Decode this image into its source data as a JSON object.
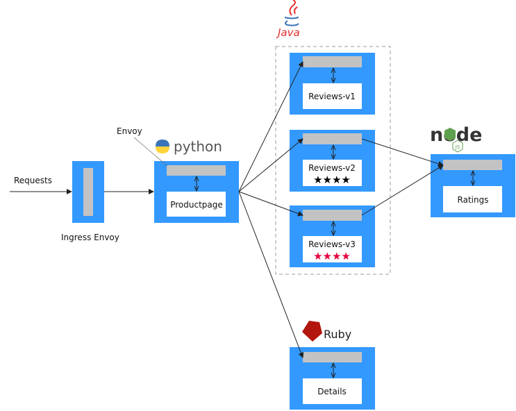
{
  "labels": {
    "requests": "Requests",
    "envoy": "Envoy",
    "ingress": "Ingress Envoy"
  },
  "services": {
    "productpage": "Productpage",
    "reviews_v1": "Reviews-v1",
    "reviews_v2": "Reviews-v2",
    "reviews_v3": "Reviews-v3",
    "ratings": "Ratings",
    "details": "Details"
  },
  "ratings_stars": {
    "reviews_v2": "★★★★",
    "reviews_v3": "★★★★"
  },
  "logos": {
    "java": "Java",
    "python": "python",
    "ruby": "Ruby",
    "node": "node",
    "node_js": "JS"
  },
  "colors": {
    "service_box": "#3399FF",
    "sidecar": "#C3C3C3",
    "stars_v2": "#000000",
    "stars_v3": "#E4003C"
  }
}
